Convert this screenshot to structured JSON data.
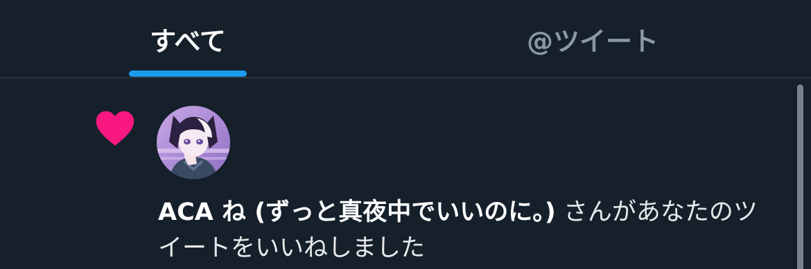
{
  "tabs": {
    "all_label": "すべて",
    "mentions_label": "@ツイート"
  },
  "notification": {
    "icon": "heart-icon",
    "user_name": "ACA ね (ずっと真夜中でいいのに。)",
    "message": " さんがあなたのツイートをいいねしました"
  },
  "colors": {
    "background": "#15202b",
    "accent": "#1d9bf0",
    "like": "#f91880",
    "divider": "#38444d"
  }
}
